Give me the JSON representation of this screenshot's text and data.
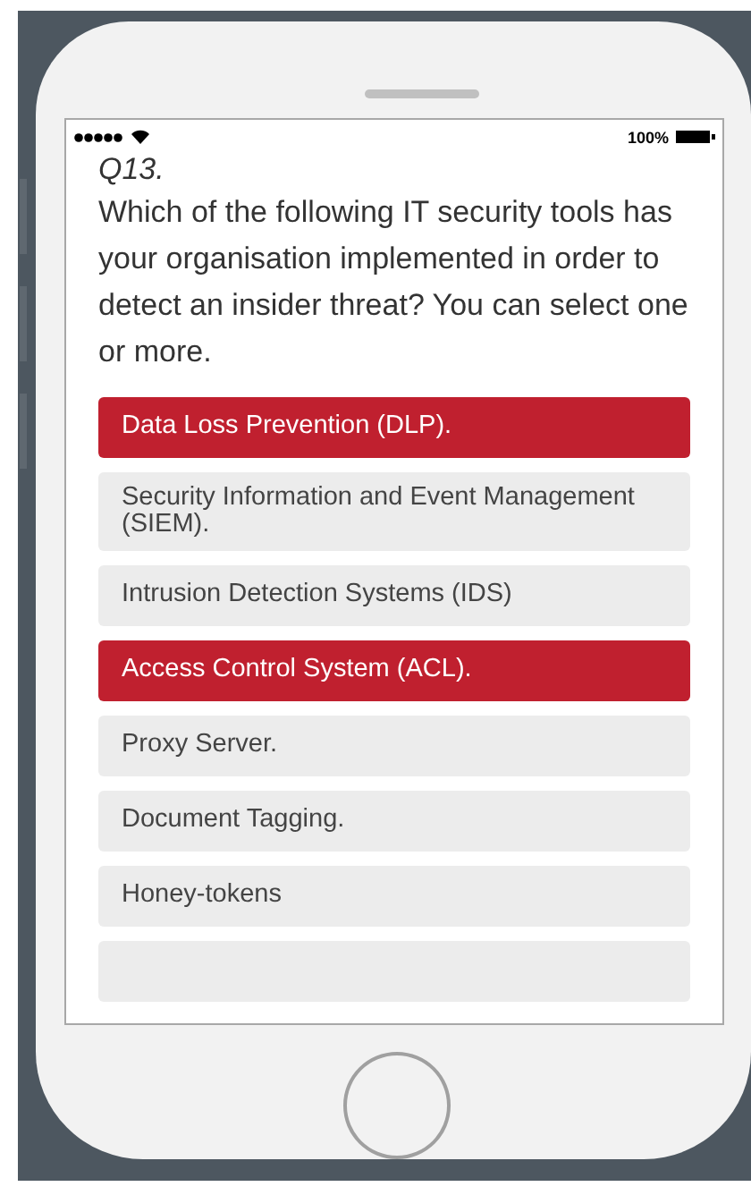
{
  "status_bar": {
    "battery_text": "100%"
  },
  "question": {
    "number": "Q13.",
    "text": "Which of the following IT security tools has your organisation implemented in order to detect an insider threat? You can select one or more."
  },
  "options": [
    {
      "label": "Data Loss Prevention (DLP).",
      "selected": true
    },
    {
      "label": "Security Information and Event Management (SIEM).",
      "selected": false
    },
    {
      "label": "Intrusion Detection Systems (IDS)",
      "selected": false
    },
    {
      "label": "Access Control System (ACL).",
      "selected": true
    },
    {
      "label": "Proxy Server.",
      "selected": false
    },
    {
      "label": "Document Tagging.",
      "selected": false
    },
    {
      "label": "Honey-tokens",
      "selected": false
    },
    {
      "selected": false
    }
  ]
}
